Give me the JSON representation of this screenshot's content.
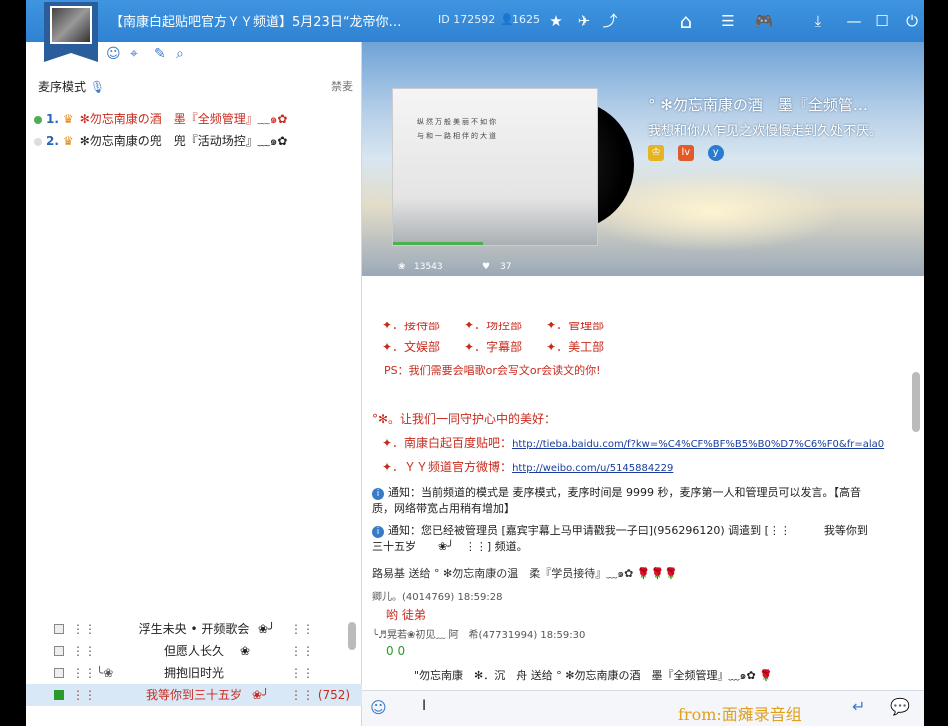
{
  "title": "【南康白起贴吧官方ＹＹ频道】5月23日“龙帝你…",
  "channel_id": "ID 172592",
  "online_count": "1625",
  "left": {
    "mic_mode": "麦序模式",
    "ban": "禁麦",
    "queue": [
      {
        "num": "1.",
        "name": "✻勿忘南康の酒　墨『全频管理』﹏๑✿",
        "dot": "#4caf50"
      },
      {
        "num": "2.",
        "name": "✻勿忘南康の兜　兜『活动场控』﹏๑✿",
        "dot": "#cccccc"
      }
    ],
    "members": [
      {
        "name": "浮生未央 • 开频歌会",
        "bars": "⋮⋮",
        "tail": "⋮⋮",
        "mid": "❀╯"
      },
      {
        "name": "但愿人长久",
        "bars": "⋮⋮",
        "tail": "⋮⋮",
        "mid": "❀"
      },
      {
        "name": "拥抱旧时光",
        "bars": "⋮⋮╰❀",
        "tail": "⋮⋮",
        "mid": ""
      },
      {
        "name": "我等你到三十五岁",
        "bars": "⋮⋮",
        "tail": "⋮⋮ (752)",
        "mid": "❀╯"
      }
    ]
  },
  "banner": {
    "anchor_name": "° ✻勿忘南康の酒　墨『全频管…",
    "anchor_sign": "我想和你从乍见之欢慢慢走到久处不厌。",
    "album_line1": "纵然万般美丽不如你",
    "album_line2": "与和一路相伴的大道",
    "flowers": "13543",
    "hearts": "37"
  },
  "chat": {
    "dept_row0": "✦．接待部　　✦．场控部　　✦．管理部",
    "dept_row1": "✦．文娱部　　✦．字幕部　　✦．美工部",
    "ps": "PS：我们需要会唱歌or会写文or会读文的你!",
    "guard": "°✻。让我们一同守护心中的美好：",
    "tieba_label": "✦．南康白起百度贴吧：",
    "tieba_url": "http://tieba.baidu.com/f?kw=%C4%CF%BF%B5%B0%D7%C6%F0&fr=ala0",
    "weibo_label": "✦．ＹＹ频道官方微博：",
    "weibo_url": "http://weibo.com/u/5145884229",
    "notice1a": "通知：当前频道的模式是 麦序模式，麦序时间是 9999 秒，麦序第一人和管理员可以发言。【高音",
    "notice1b": "质，网络带宽占用稍有增加】",
    "notice2a": "通知：您已经被管理员 [嘉宾宇幕上马甲请戳我一子曰](956296120) 调遣到 [⋮⋮　　　我等你到",
    "notice2b": "三十五岁　　❀╯　⋮⋮] 频道。",
    "gift1": "路易基 送给 ° ✻勿忘南康の温　柔『学员接待』﹏๑✿",
    "msg1_user": "卿儿。(4014769) 18:59:28",
    "msg1_text": "哟 徒弟",
    "msg2_user": "╰♬晃若❀初见﹏ 阿　希(47731994) 18:59:30",
    "msg2_text": "0 0",
    "gift2": "\"勿忘南康　✻．沉　舟 送给 ° ✻勿忘南康の酒　墨『全频管理』﹏๑✿"
  },
  "watermark": "from:面瘫录音组"
}
